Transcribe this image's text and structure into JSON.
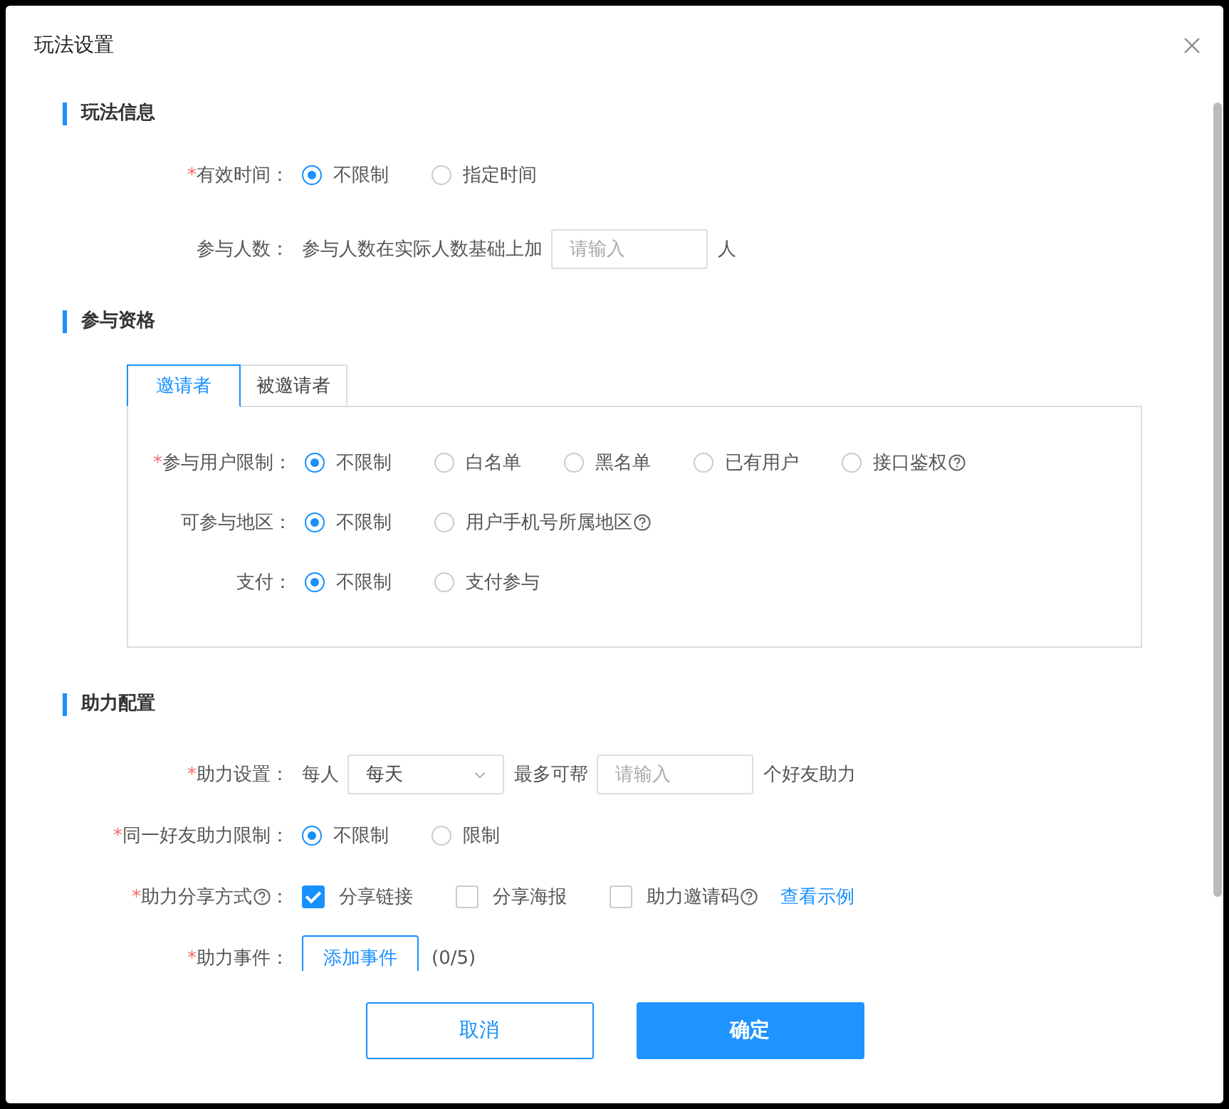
{
  "dialog": {
    "title": "玩法设置"
  },
  "sections": [
    {
      "title": "玩法信息",
      "rows": [
        {
          "mark": "*",
          "label": "有效时间：",
          "kind": "radio",
          "options": [
            {
              "label": "不限制",
              "selected": true
            },
            {
              "label": "指定时间",
              "selected": false
            }
          ]
        },
        {
          "label": "参与人数：",
          "kind": "inline",
          "items": [
            {
              "kind": "text",
              "text": "参与人数在实际人数基础上加"
            },
            {
              "kind": "input",
              "placeholder": "请输入"
            },
            {
              "kind": "text",
              "text": "人"
            }
          ]
        }
      ]
    },
    {
      "title": "参与资格",
      "tabs": [
        {
          "label": "邀请者",
          "selected": true
        },
        {
          "label": "被邀请者",
          "selected": false
        }
      ],
      "rows": [
        {
          "mark": "*",
          "label": "参与用户限制：",
          "kind": "radio",
          "options": [
            {
              "label": "不限制",
              "selected": true
            },
            {
              "label": "白名单",
              "selected": false
            },
            {
              "label": "黑名单",
              "selected": false
            },
            {
              "label": "已有用户",
              "selected": false
            },
            {
              "label": "接口鉴权",
              "selected": false,
              "help": true
            }
          ]
        },
        {
          "label": "可参与地区：",
          "kind": "radio",
          "options": [
            {
              "label": "不限制",
              "selected": true
            },
            {
              "label": "用户手机号所属地区",
              "selected": false,
              "help": true
            }
          ]
        },
        {
          "label": "支付：",
          "kind": "radio",
          "options": [
            {
              "label": "不限制",
              "selected": true
            },
            {
              "label": "支付参与",
              "selected": false
            }
          ]
        }
      ]
    },
    {
      "title": "助力配置",
      "rows": [
        {
          "mark": "*",
          "label": "助力设置：",
          "kind": "inline",
          "items": [
            {
              "kind": "text",
              "text": "每人"
            },
            {
              "kind": "select",
              "value": "每天"
            },
            {
              "kind": "text",
              "text": "最多可帮"
            },
            {
              "kind": "input",
              "placeholder": "请输入"
            },
            {
              "kind": "text",
              "text": "个好友助力"
            }
          ]
        },
        {
          "mark": "*",
          "label": "同一好友助力限制：",
          "kind": "radio",
          "options": [
            {
              "label": "不限制",
              "selected": true
            },
            {
              "label": "限制",
              "selected": false
            }
          ]
        },
        {
          "mark": "*",
          "label": "助力分享方式",
          "help": true,
          "colon": "：",
          "kind": "checkbox",
          "options": [
            {
              "label": "分享链接",
              "checked": true
            },
            {
              "label": "分享海报",
              "checked": false
            },
            {
              "label": "助力邀请码",
              "checked": false,
              "help": true
            }
          ],
          "link": "查看示例"
        },
        {
          "mark": "*",
          "label": "助力事件：",
          "kind": "button",
          "button": "添加事件",
          "count": "(0/5)"
        }
      ]
    }
  ],
  "buttons": [
    {
      "label": "取消",
      "kind": "secondary"
    },
    {
      "label": "确定",
      "kind": "primary"
    }
  ]
}
